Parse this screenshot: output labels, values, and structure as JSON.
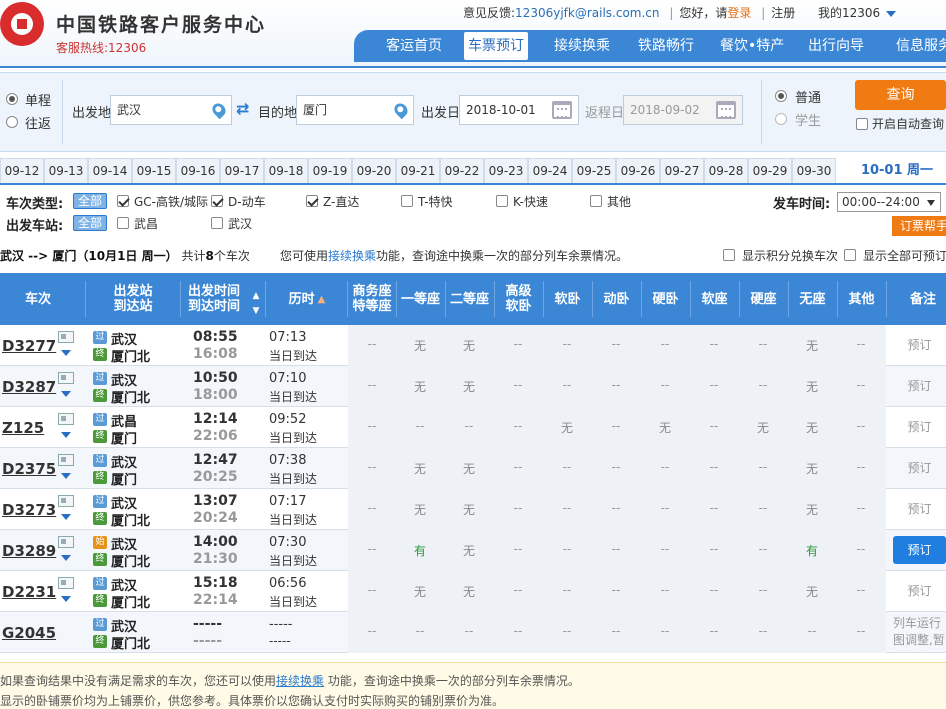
{
  "header": {
    "site_title": "中国铁路客户服务中心",
    "hotline": "客服热线:12306",
    "feedback_label": "意见反馈:",
    "feedback_email": "12306yjfk@rails.com.cn",
    "greeting": "您好，请",
    "login": "登录",
    "register": "注册",
    "account": "我的12306"
  },
  "nav": [
    {
      "label": "客运首页"
    },
    {
      "label": "车票预订"
    },
    {
      "label": "接续换乘"
    },
    {
      "label": "铁路畅行"
    },
    {
      "label": "餐饮•特产"
    },
    {
      "label": "出行向导"
    },
    {
      "label": "信息服务"
    }
  ],
  "query": {
    "oneway": "单程",
    "roundtrip": "往返",
    "from_label": "出发地",
    "from_value": "武汉",
    "to_label": "目的地",
    "to_value": "厦门",
    "date_label": "出发日",
    "date_value": "2018-10-01",
    "return_label": "返程日",
    "return_value": "2018-09-02",
    "normal": "普通",
    "student": "学生",
    "search": "查询",
    "auto_query": "开启自动查询"
  },
  "dates": [
    "09-12",
    "09-13",
    "09-14",
    "09-15",
    "09-16",
    "09-17",
    "09-18",
    "09-19",
    "09-20",
    "09-21",
    "09-22",
    "09-23",
    "09-24",
    "09-25",
    "09-26",
    "09-27",
    "09-28",
    "09-29",
    "09-30"
  ],
  "current_date": "10-01 周一",
  "filters": {
    "type_label": "车次类型:",
    "all": "全部",
    "types": [
      "GC-高铁/城际",
      "D-动车",
      "Z-直达",
      "T-特快",
      "K-快速",
      "其他"
    ],
    "station_label": "出发车站:",
    "stations": [
      "武昌",
      "武汉"
    ],
    "time_label": "发车时间:",
    "time_value": "00:00--24:00",
    "booking_help": "订票帮手"
  },
  "summary": {
    "route": "武汉 --> 厦门（10月1日  周一）",
    "count_pre": "共计",
    "count": "8",
    "count_post": "个车次",
    "tip_pre": "您可使用",
    "tip_link": "接续换乘",
    "tip_post": "功能，查询途中换乘一次的部分列车余票情况。",
    "show_points": "显示积分兑换车次",
    "show_all": "显示全部可预订"
  },
  "columns": {
    "train": "车次",
    "station1": "出发站",
    "station2": "到达站",
    "time1": "出发时间",
    "time2": "到达时间",
    "duration": "历时",
    "biz1": "商务座",
    "biz2": "特等座",
    "first": "一等座",
    "second": "二等座",
    "ss1": "高级",
    "ss2": "软卧",
    "soft_sleeper": "软卧",
    "moving_sleeper": "动卧",
    "hard_sleeper": "硬卧",
    "soft_seat": "软座",
    "hard_seat": "硬座",
    "no_seat": "无座",
    "other": "其他",
    "note": "备注"
  },
  "trains": [
    {
      "no": "D3277",
      "from_tag": "过",
      "from": "武汉",
      "to_tag": "终",
      "to": "厦门北",
      "dep": "08:55",
      "arr": "16:08",
      "dur": "07:13",
      "arrive_day": "当日到达",
      "seats": [
        "--",
        "无",
        "无",
        "--",
        "--",
        "--",
        "--",
        "--",
        "--",
        "无",
        "--"
      ],
      "note": "预订",
      "note_active": false
    },
    {
      "no": "D3287",
      "from_tag": "过",
      "from": "武汉",
      "to_tag": "终",
      "to": "厦门北",
      "dep": "10:50",
      "arr": "18:00",
      "dur": "07:10",
      "arrive_day": "当日到达",
      "seats": [
        "--",
        "无",
        "无",
        "--",
        "--",
        "--",
        "--",
        "--",
        "--",
        "无",
        "--"
      ],
      "note": "预订",
      "note_active": false
    },
    {
      "no": "Z125",
      "from_tag": "过",
      "from": "武昌",
      "to_tag": "终",
      "to": "厦门",
      "dep": "12:14",
      "arr": "22:06",
      "dur": "09:52",
      "arrive_day": "当日到达",
      "seats": [
        "--",
        "--",
        "--",
        "--",
        "无",
        "--",
        "无",
        "--",
        "无",
        "无",
        "--"
      ],
      "note": "预订",
      "note_active": false
    },
    {
      "no": "D2375",
      "from_tag": "过",
      "from": "武汉",
      "to_tag": "终",
      "to": "厦门",
      "dep": "12:47",
      "arr": "20:25",
      "dur": "07:38",
      "arrive_day": "当日到达",
      "seats": [
        "--",
        "无",
        "无",
        "--",
        "--",
        "--",
        "--",
        "--",
        "--",
        "无",
        "--"
      ],
      "note": "预订",
      "note_active": false
    },
    {
      "no": "D3273",
      "from_tag": "过",
      "from": "武汉",
      "to_tag": "终",
      "to": "厦门北",
      "dep": "13:07",
      "arr": "20:24",
      "dur": "07:17",
      "arrive_day": "当日到达",
      "seats": [
        "--",
        "无",
        "无",
        "--",
        "--",
        "--",
        "--",
        "--",
        "--",
        "无",
        "--"
      ],
      "note": "预订",
      "note_active": false
    },
    {
      "no": "D3289",
      "from_tag": "始",
      "from": "武汉",
      "to_tag": "终",
      "to": "厦门北",
      "dep": "14:00",
      "arr": "21:30",
      "dur": "07:30",
      "arrive_day": "当日到达",
      "seats": [
        "--",
        "有",
        "无",
        "--",
        "--",
        "--",
        "--",
        "--",
        "--",
        "有",
        "--"
      ],
      "note": "预订",
      "note_active": true
    },
    {
      "no": "D2231",
      "from_tag": "过",
      "from": "武汉",
      "to_tag": "终",
      "to": "厦门北",
      "dep": "15:18",
      "arr": "22:14",
      "dur": "06:56",
      "arrive_day": "当日到达",
      "seats": [
        "--",
        "无",
        "无",
        "--",
        "--",
        "--",
        "--",
        "--",
        "--",
        "无",
        "--"
      ],
      "note": "预订",
      "note_active": false
    },
    {
      "no": "G2045",
      "from_tag": "过",
      "from": "武汉",
      "to_tag": "终",
      "to": "厦门北",
      "dep": "-----",
      "arr": "-----",
      "dur": "-----",
      "arrive_day": "-----",
      "seats": [
        "--",
        "--",
        "--",
        "--",
        "--",
        "--",
        "--",
        "--",
        "--",
        "--",
        "--"
      ],
      "note": "列车运行图调整,暂停发售",
      "note_active": false
    }
  ],
  "footer": {
    "line1_pre": "如果查询结果中没有满足需求的车次，您还可以使用",
    "line1_link": "接续换乘",
    "line1_post": " 功能，查询途中换乘一次的部分列车余票情况。",
    "line2": "显示的卧铺票价均为上铺票价，供您参考。具体票价以您确认支付时实际购买的铺别票价为准。"
  }
}
